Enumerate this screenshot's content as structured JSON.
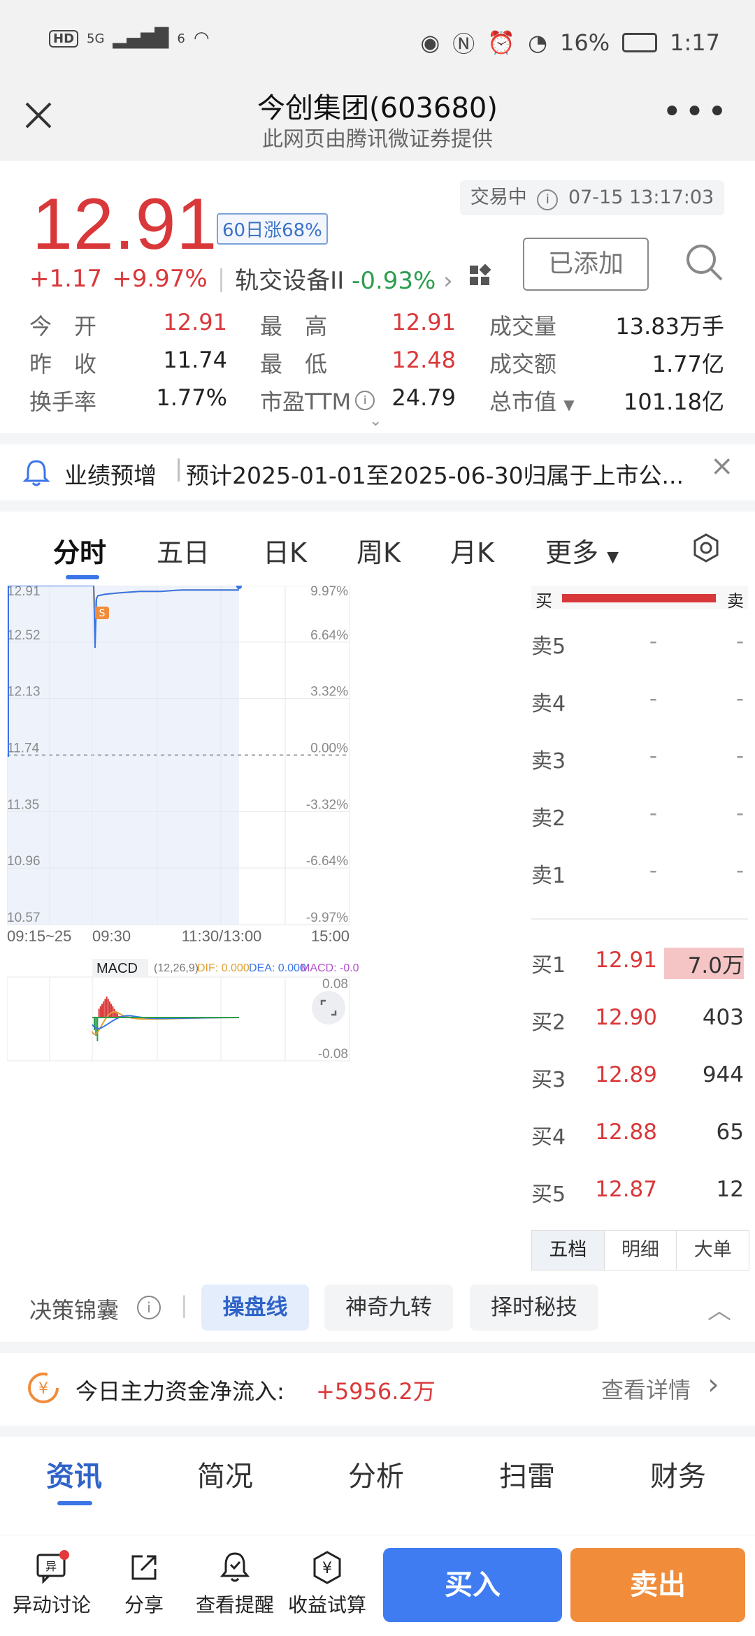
{
  "status_bar": {
    "hd": "HD",
    "net1": "5G",
    "net2": "6",
    "battery": "16%",
    "time": "1:17"
  },
  "header": {
    "title": "今创集团(603680)",
    "subtitle": "此网页由腾讯微证券提供"
  },
  "quote": {
    "price": "12.91",
    "rise_badge": "60日涨68%",
    "trade_status": "交易中",
    "trade_time": "07-15 13:17:03",
    "change": "+1.17",
    "change_pct": "+9.97%",
    "sector": "轨交设备II",
    "sector_pct": "-0.93%",
    "added_label": "已添加"
  },
  "stats": [
    {
      "label": "今　开",
      "value": "12.91",
      "color": "red"
    },
    {
      "label": "最　高",
      "value": "12.91",
      "color": "red"
    },
    {
      "label": "成交量",
      "value": "13.83万手",
      "color": "dark"
    },
    {
      "label": "昨　收",
      "value": "11.74",
      "color": "dark"
    },
    {
      "label": "最　低",
      "value": "12.48",
      "color": "red"
    },
    {
      "label": "成交额",
      "value": "1.77亿",
      "color": "dark"
    },
    {
      "label": "换手率",
      "value": "1.77%",
      "color": "dark"
    },
    {
      "label": "市盈TTM",
      "value": "24.79",
      "color": "dark"
    },
    {
      "label": "总市值",
      "value": "101.18亿",
      "color": "dark"
    }
  ],
  "notice": {
    "tag": "业绩预增",
    "text": "预计2025-01-01至2025-06-30归属于上市公..."
  },
  "chart_tabs": [
    "分时",
    "五日",
    "日K",
    "周K",
    "月K",
    "更多"
  ],
  "chart_data": {
    "type": "line",
    "left_ticks": [
      "12.91",
      "12.52",
      "12.13",
      "11.74",
      "11.35",
      "10.96",
      "10.57"
    ],
    "right_ticks": [
      "9.97%",
      "6.64%",
      "3.32%",
      "0.00%",
      "-3.32%",
      "-6.64%",
      "-9.97%"
    ],
    "x_ticks": [
      "09:15~25",
      "09:30",
      "11:30/13:00",
      "15:00"
    ],
    "ylim": [
      10.57,
      12.91
    ],
    "price_series": [
      12.91,
      12.91,
      12.48,
      12.82,
      12.84,
      12.85,
      12.86,
      12.87,
      12.87,
      12.88,
      12.88,
      12.88,
      12.88,
      12.88
    ],
    "avg_series": [
      12.91,
      12.91,
      12.75,
      12.82,
      12.84,
      12.85,
      12.86,
      12.87,
      12.87,
      12.88,
      12.88,
      12.88,
      12.88,
      12.88
    ],
    "macd": {
      "label": "MACD",
      "params": "(12,26,9)",
      "dif": "DIF: 0.000",
      "dea": "DEA: 0.000",
      "macd": "MACD: -0.0",
      "ymax": "0.08",
      "ymin": "-0.08"
    }
  },
  "orderbook": {
    "buy_label": "买",
    "sell_label": "卖",
    "asks": [
      {
        "label": "卖5",
        "price": "-",
        "vol": "-"
      },
      {
        "label": "卖4",
        "price": "-",
        "vol": "-"
      },
      {
        "label": "卖3",
        "price": "-",
        "vol": "-"
      },
      {
        "label": "卖2",
        "price": "-",
        "vol": "-"
      },
      {
        "label": "卖1",
        "price": "-",
        "vol": "-"
      }
    ],
    "bids": [
      {
        "label": "买1",
        "price": "12.91",
        "vol": "7.0万"
      },
      {
        "label": "买2",
        "price": "12.90",
        "vol": "403"
      },
      {
        "label": "买3",
        "price": "12.89",
        "vol": "944"
      },
      {
        "label": "买4",
        "price": "12.88",
        "vol": "65"
      },
      {
        "label": "买5",
        "price": "12.87",
        "vol": "12"
      }
    ],
    "tabs": [
      "五档",
      "明细",
      "大单"
    ]
  },
  "decision": {
    "label": "决策锦囊",
    "pills": [
      "操盘线",
      "神奇九转",
      "择时秘技"
    ]
  },
  "capital_flow": {
    "label": "今日主力资金净流入:",
    "value": "+5956.2万",
    "link": "查看详情"
  },
  "info_tabs": [
    "资讯",
    "简况",
    "分析",
    "扫雷",
    "财务"
  ],
  "bottom_nav": {
    "discuss": "异动讨论",
    "share": "分享",
    "alert": "查看提醒",
    "calc": "收益试算",
    "buy": "买入",
    "sell": "卖出"
  },
  "colors": {
    "red": "#d9383a",
    "green": "#2e9d4f",
    "blue": "#3a74e8",
    "orange": "#f08c3a"
  }
}
